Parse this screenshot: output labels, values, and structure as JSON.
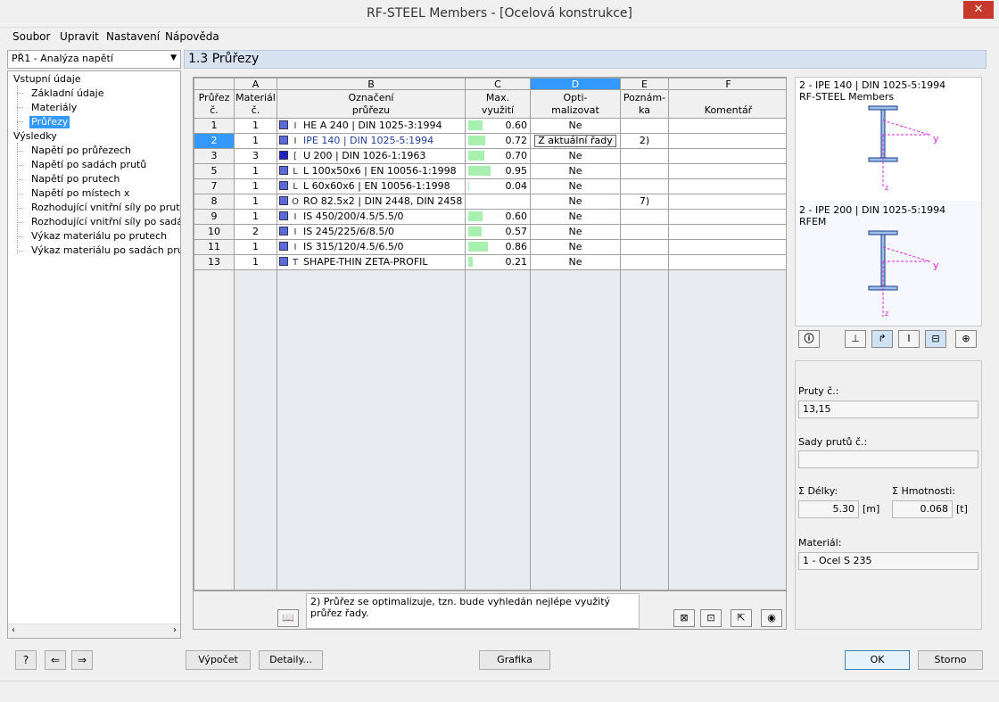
{
  "window": {
    "title": "RF-STEEL Members - [Ocelová konstrukce]",
    "close": "✕"
  },
  "menu": [
    {
      "label": "Soubor"
    },
    {
      "label": "Upravit"
    },
    {
      "label": "Nastavení"
    },
    {
      "label": "Nápověda"
    }
  ],
  "nav": {
    "combo": "PŘ1 - Analýza napětí",
    "tree": [
      {
        "label": "Vstupní údaje",
        "level": 0
      },
      {
        "label": "Základní údaje",
        "level": 1
      },
      {
        "label": "Materiály",
        "level": 1
      },
      {
        "label": "Průřezy",
        "level": 1,
        "selected": true
      },
      {
        "label": "Výsledky",
        "level": 0
      },
      {
        "label": "Napětí po průřezech",
        "level": 1
      },
      {
        "label": "Napětí po sadách prutů",
        "level": 1
      },
      {
        "label": "Napětí po prutech",
        "level": 1
      },
      {
        "label": "Napětí po místech x",
        "level": 1
      },
      {
        "label": "Rozhodující vnitřní síly po prutech",
        "level": 1
      },
      {
        "label": "Rozhodující vnitřní síly po sadách p",
        "level": 1
      },
      {
        "label": "Výkaz materiálu po prutech",
        "level": 1
      },
      {
        "label": "Výkaz materiálu po sadách prutů",
        "level": 1
      }
    ]
  },
  "section_title": "1.3 Průřezy",
  "table": {
    "col_letters": [
      "A",
      "B",
      "C",
      "D",
      "E",
      "F"
    ],
    "headers": {
      "row": [
        "Průřez",
        "č."
      ],
      "A": [
        "Materiál",
        "č."
      ],
      "B": [
        "Označení",
        "průřezu"
      ],
      "C": [
        "Max.",
        "využití"
      ],
      "D": [
        "Opti-",
        "malizovat"
      ],
      "E": [
        "Poznám-",
        "ka"
      ],
      "F": [
        "",
        "Komentář"
      ]
    },
    "rows": [
      {
        "no": "1",
        "mat": "1",
        "icon": "I",
        "color": "#5a6ad8",
        "name": "HE A 240 | DIN 1025-3:1994",
        "util": "0.60",
        "util_frac": 0.6,
        "opt": "Ne",
        "note": "",
        "comment": ""
      },
      {
        "no": "2",
        "mat": "1",
        "icon": "I",
        "color": "#5a6ad8",
        "name": "IPE 140 | DIN 1025-5:1994",
        "util": "0.72",
        "util_frac": 0.72,
        "opt": "Z aktuální řady",
        "note": "2)",
        "comment": "",
        "selected": true
      },
      {
        "no": "3",
        "mat": "3",
        "icon": "[",
        "color": "#2020c0",
        "name": "U 200 | DIN 1026-1:1963",
        "util": "0.70",
        "util_frac": 0.7,
        "opt": "Ne",
        "note": "",
        "comment": ""
      },
      {
        "no": "5",
        "mat": "1",
        "icon": "L",
        "color": "#5a6ad8",
        "name": "L 100x50x6 | EN 10056-1:1998",
        "util": "0.95",
        "util_frac": 0.95,
        "opt": "Ne",
        "note": "",
        "comment": ""
      },
      {
        "no": "7",
        "mat": "1",
        "icon": "L",
        "color": "#5a6ad8",
        "name": "L 60x60x6 | EN 10056-1:1998",
        "util": "0.04",
        "util_frac": 0.04,
        "opt": "Ne",
        "note": "",
        "comment": ""
      },
      {
        "no": "8",
        "mat": "1",
        "icon": "O",
        "color": "#5a6ad8",
        "name": "RO 82.5x2 | DIN 2448, DIN 2458",
        "util": "",
        "util_frac": 0,
        "opt": "Ne",
        "note": "7)",
        "comment": ""
      },
      {
        "no": "9",
        "mat": "1",
        "icon": "I",
        "color": "#5a6ad8",
        "name": "IS 450/200/4.5/5.5/0",
        "util": "0.60",
        "util_frac": 0.6,
        "opt": "Ne",
        "note": "",
        "comment": ""
      },
      {
        "no": "10",
        "mat": "2",
        "icon": "I",
        "color": "#5a6ad8",
        "name": "IS 245/225/6/8.5/0",
        "util": "0.57",
        "util_frac": 0.57,
        "opt": "Ne",
        "note": "",
        "comment": ""
      },
      {
        "no": "11",
        "mat": "1",
        "icon": "I",
        "color": "#5a6ad8",
        "name": "IS 315/120/4.5/6.5/0",
        "util": "0.86",
        "util_frac": 0.86,
        "opt": "Ne",
        "note": "",
        "comment": ""
      },
      {
        "no": "13",
        "mat": "1",
        "icon": "T",
        "color": "#5a6ad8",
        "name": "SHAPE-THIN ZETA-PROFIL",
        "util": "0.21",
        "util_frac": 0.21,
        "opt": "Ne",
        "note": "",
        "comment": ""
      }
    ]
  },
  "note": "2) Průřez se optimalizuje, tzn. bude vyhledán nejlépe využitý průřez řady.",
  "preview": {
    "top_line1": "2 - IPE 140 | DIN 1025-5:1994",
    "top_line2": "RF-STEEL Members",
    "bottom_line1": "2 - IPE 200 | DIN 1025-5:1994",
    "bottom_line2": "RFEM",
    "axis_y": "y",
    "axis_z": "z"
  },
  "props": {
    "pruty_label": "Pruty č.:",
    "pruty_value": "13,15",
    "sady_label": "Sady prutů č.:",
    "sady_value": "",
    "delky_label": "Σ Délky:",
    "delky_value": "5.30",
    "delky_unit": "[m]",
    "hmot_label": "Σ Hmotnosti:",
    "hmot_value": "0.068",
    "hmot_unit": "[t]",
    "material_label": "Materiál:",
    "material_value": "1 - Ocel S 235"
  },
  "buttons": {
    "vypocet": "Výpočet",
    "detaily": "Detaily...",
    "grafika": "Grafika",
    "ok": "OK",
    "storno": "Storno"
  },
  "colors": {
    "accent": "#3399ff",
    "util_bar": "#a8f0b0",
    "header_bg": "#d6e2f0",
    "axis": "#e020e0"
  }
}
